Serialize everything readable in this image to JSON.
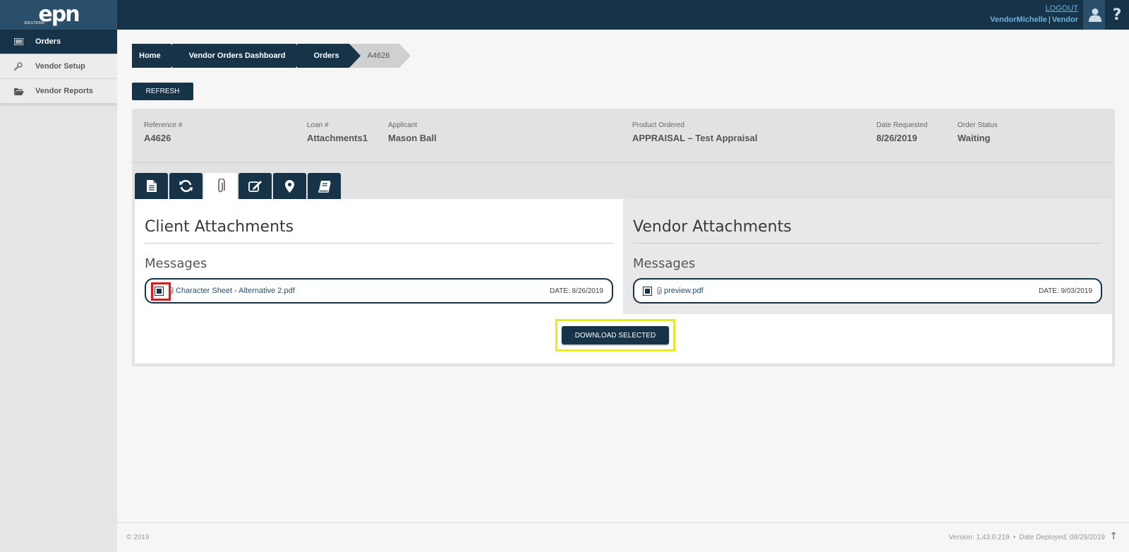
{
  "brand": {
    "logo_text": "epn",
    "logo_sub": "SOLUTIONS"
  },
  "header": {
    "logout_label": "LOGOUT",
    "username": "VendorMichelle",
    "separator": "|",
    "role": "Vendor",
    "help_glyph": "?",
    "user_icon": "user-icon"
  },
  "sidebar": {
    "items": [
      {
        "label": "Orders",
        "icon": "list-icon",
        "active": true
      },
      {
        "label": "Vendor Setup",
        "icon": "wrench-icon",
        "active": false
      },
      {
        "label": "Vendor Reports",
        "icon": "folder-open-icon",
        "active": false
      }
    ]
  },
  "breadcrumb": {
    "items": [
      "Home",
      "Vendor Orders Dashboard",
      "Orders",
      "A4626"
    ]
  },
  "refresh_label": "REFRESH",
  "order": {
    "reference": {
      "label": "Reference #",
      "value": "A4626"
    },
    "loan": {
      "label": "Loan #",
      "value": "Attachments1"
    },
    "applicant": {
      "label": "Applicant",
      "value": "Mason Ball"
    },
    "product": {
      "label": "Product Ordered",
      "value": "APPRAISAL – Test Appraisal"
    },
    "date_requested": {
      "label": "Date Requested",
      "value": "8/26/2019"
    },
    "status": {
      "label": "Order Status",
      "value": "Waiting"
    }
  },
  "tabs": [
    {
      "icon": "document-icon",
      "active": false
    },
    {
      "icon": "refresh-icon",
      "active": false
    },
    {
      "icon": "paperclip-icon",
      "active": true
    },
    {
      "icon": "edit-icon",
      "active": false
    },
    {
      "icon": "map-marker-icon",
      "active": false
    },
    {
      "icon": "book-icon",
      "active": false
    }
  ],
  "client_attachments": {
    "title": "Client Attachments",
    "subtitle": "Messages",
    "files": [
      {
        "name": "Character Sheet - Alternative 2.pdf",
        "date": "DATE: 8/26/2019",
        "checked": true
      }
    ]
  },
  "vendor_attachments": {
    "title": "Vendor Attachments",
    "subtitle": "Messages",
    "files": [
      {
        "name": "preview.pdf",
        "date": "DATE: 9/03/2019",
        "checked": true
      }
    ]
  },
  "download_label": "DOWNLOAD SELECTED",
  "footer": {
    "copyright": "© 2019",
    "version": "Version: 1.43.0.219",
    "bullet": "•",
    "deployed": "Date Deployed: 08/29/2019",
    "top_arrow": "↑"
  },
  "colors": {
    "primary": "#163348",
    "accent_blue": "#6fb2e0",
    "highlight_red": "#e2151b",
    "highlight_yellow": "#e8e823"
  }
}
